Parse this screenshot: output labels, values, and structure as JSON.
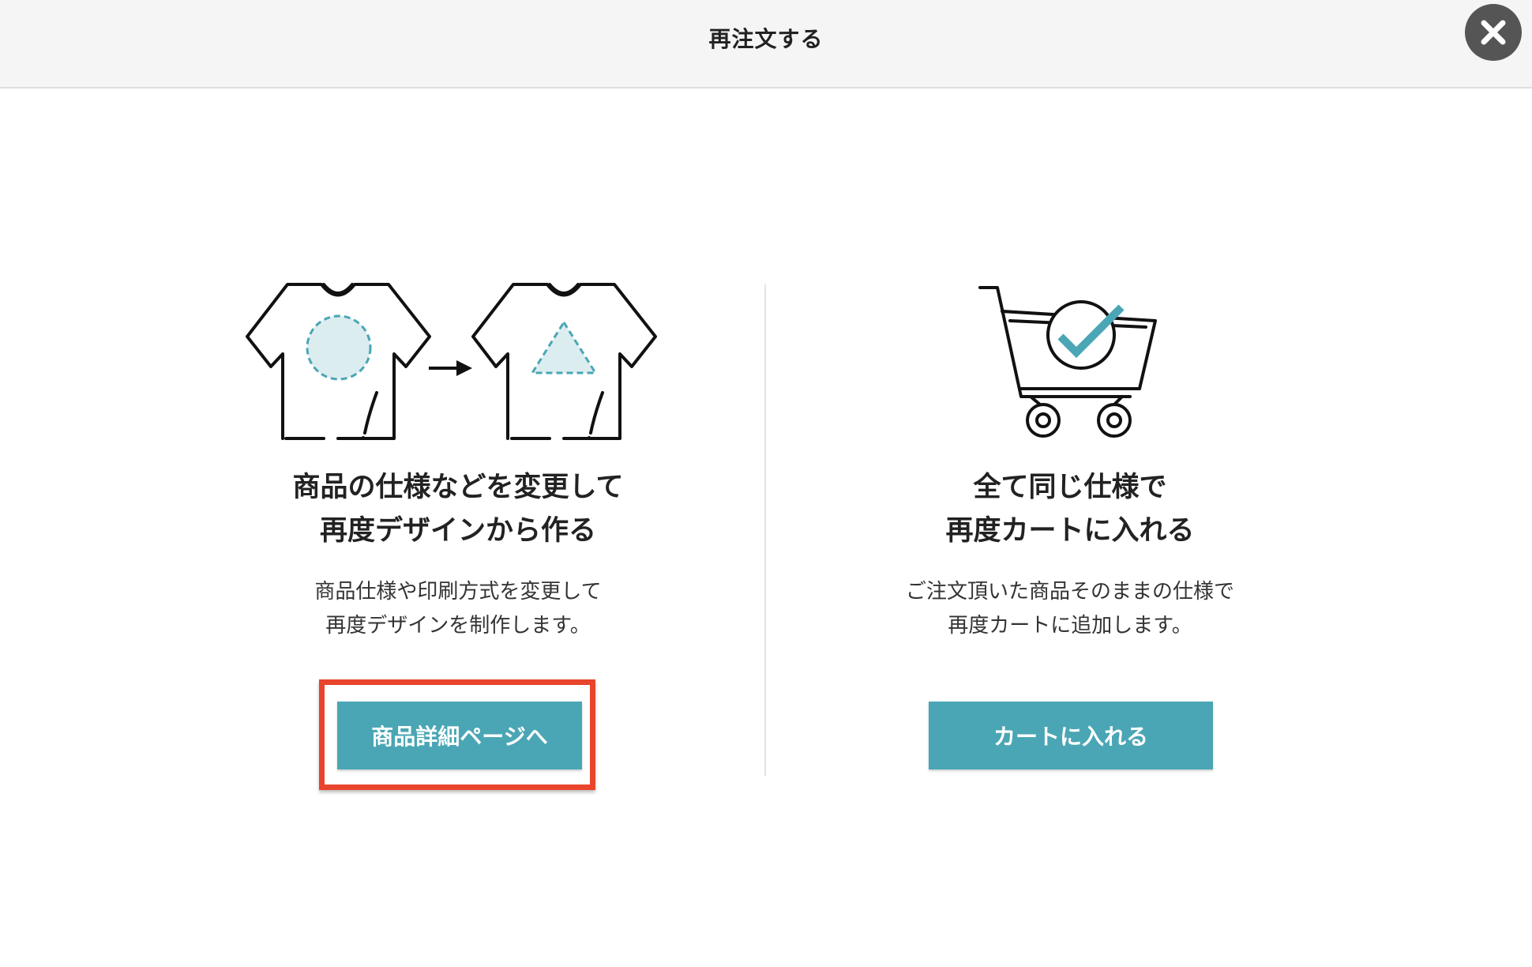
{
  "header": {
    "title": "再注文する",
    "close_icon": "close-icon"
  },
  "options": [
    {
      "heading_line1": "商品の仕様などを変更して",
      "heading_line2": "再度デザインから作る",
      "desc_line1": "商品仕様や印刷方式を変更して",
      "desc_line2": "再度デザインを制作します。",
      "button_label": "商品詳細ページへ",
      "illustration": "tshirt-redesign-icon"
    },
    {
      "heading_line1": "全て同じ仕様で",
      "heading_line2": "再度カートに入れる",
      "desc_line1": "ご注文頂いた商品そのままの仕様で",
      "desc_line2": "再度カートに追加します。",
      "button_label": "カートに入れる",
      "illustration": "cart-check-icon"
    }
  ],
  "colors": {
    "accent": "#4aa6b4",
    "highlight": "#e8452c",
    "illustration_fill": "#dcedf0",
    "illustration_stroke": "#4aa6b4"
  }
}
